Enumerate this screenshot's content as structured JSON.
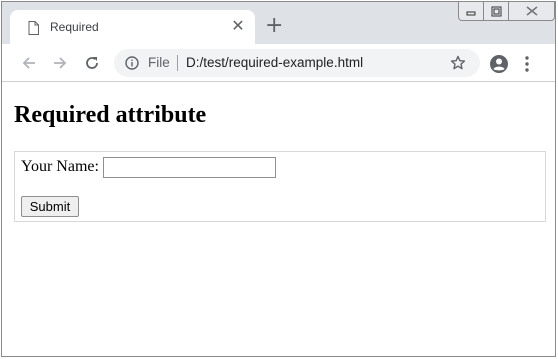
{
  "tab": {
    "title": "Required",
    "close_glyph": "✕",
    "new_tab_glyph": "+"
  },
  "omnibox": {
    "scheme_label": "File",
    "url": "D:/test/required-example.html"
  },
  "icons": {
    "favicon": "page-icon",
    "back": "back-arrow-icon",
    "forward": "forward-arrow-icon",
    "reload": "reload-icon",
    "info": "info-icon",
    "star": "star-icon",
    "profile": "profile-icon",
    "menu": "kebab-menu-icon"
  },
  "page": {
    "heading": "Required attribute",
    "form": {
      "name_label": "Your Name:",
      "name_value": "",
      "submit_label": "Submit"
    }
  },
  "colors": {
    "tabstrip_bg": "#dee1e6",
    "omnibox_bg": "#f1f3f4",
    "icon_gray": "#5f6368"
  }
}
